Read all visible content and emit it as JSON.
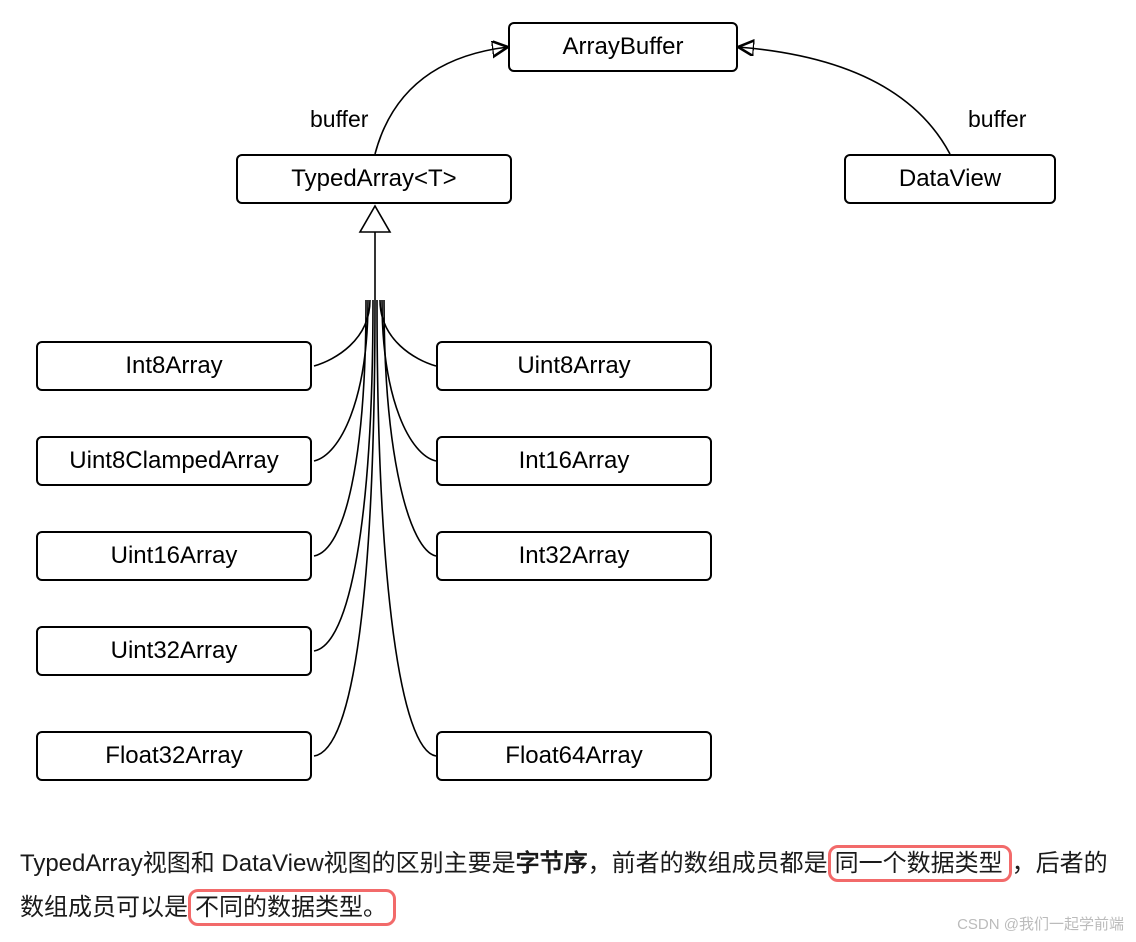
{
  "diagram": {
    "nodes": {
      "arraybuffer": "ArrayBuffer",
      "typedarray": "TypedArray<T>",
      "dataview": "DataView",
      "int8": "Int8Array",
      "uint8": "Uint8Array",
      "uint8clamped": "Uint8ClampedArray",
      "int16": "Int16Array",
      "uint16": "Uint16Array",
      "int32": "Int32Array",
      "uint32": "Uint32Array",
      "float32": "Float32Array",
      "float64": "Float64Array"
    },
    "edge_labels": {
      "buffer_left": "buffer",
      "buffer_right": "buffer"
    }
  },
  "caption": {
    "part1": "TypedArray视图和 DataView视图的区别主要是",
    "bold": "字节序",
    "part2": "，前者的数组成员都是",
    "hl1": "同一个数据类型",
    "part3": "，后者的数组成员可以是",
    "hl2": "不同的数据类型。"
  },
  "watermark": "CSDN @我们一起学前端"
}
